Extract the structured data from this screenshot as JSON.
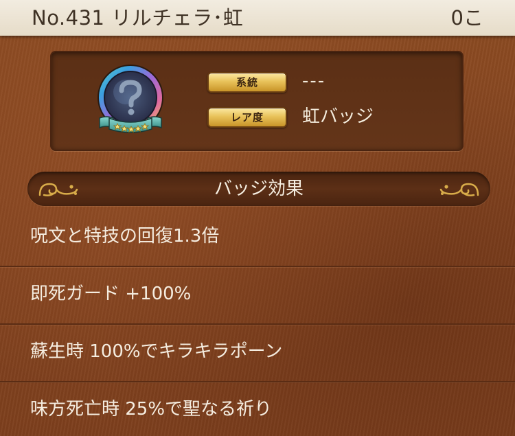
{
  "header": {
    "title": "No.431  リルチェラ･虹",
    "count": "0こ"
  },
  "info": {
    "badge_icon": "question-mark-badge-icon",
    "series_label": "系統",
    "series_value": "---",
    "rarity_label": "レア度",
    "rarity_value": "虹バッジ"
  },
  "effects_section": {
    "title": "バッジ効果",
    "items": [
      "呪文と特技の回復1.3倍",
      "即死ガード +100%",
      "蘇生時 100%でキラキラポーン",
      "味方死亡時 25%で聖なる祈り"
    ]
  },
  "colors": {
    "background": "#844420",
    "header_bg": "#eee6d6",
    "header_text": "#3e3124",
    "panel_bg": "#5b2f15",
    "pill_gold": "#e8c25a",
    "text_light": "#f5ede0"
  }
}
